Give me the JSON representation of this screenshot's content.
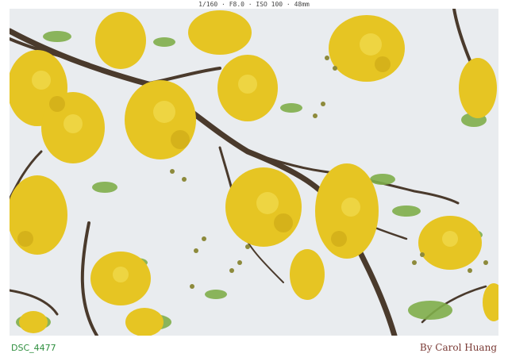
{
  "exif": {
    "text": "1/160 · F8.0 · ISO 100 · 48mm"
  },
  "caption": {
    "file_name": "DSC_4477",
    "credit": "By Carol Huang"
  },
  "photo": {
    "colors": {
      "sky": "#e9ecef",
      "branch": "#4a3a2c",
      "leaf": "#7fae4a",
      "flower": "#e6c523",
      "flower_dark": "#c9a514",
      "bud": "#8d8a3b"
    }
  }
}
